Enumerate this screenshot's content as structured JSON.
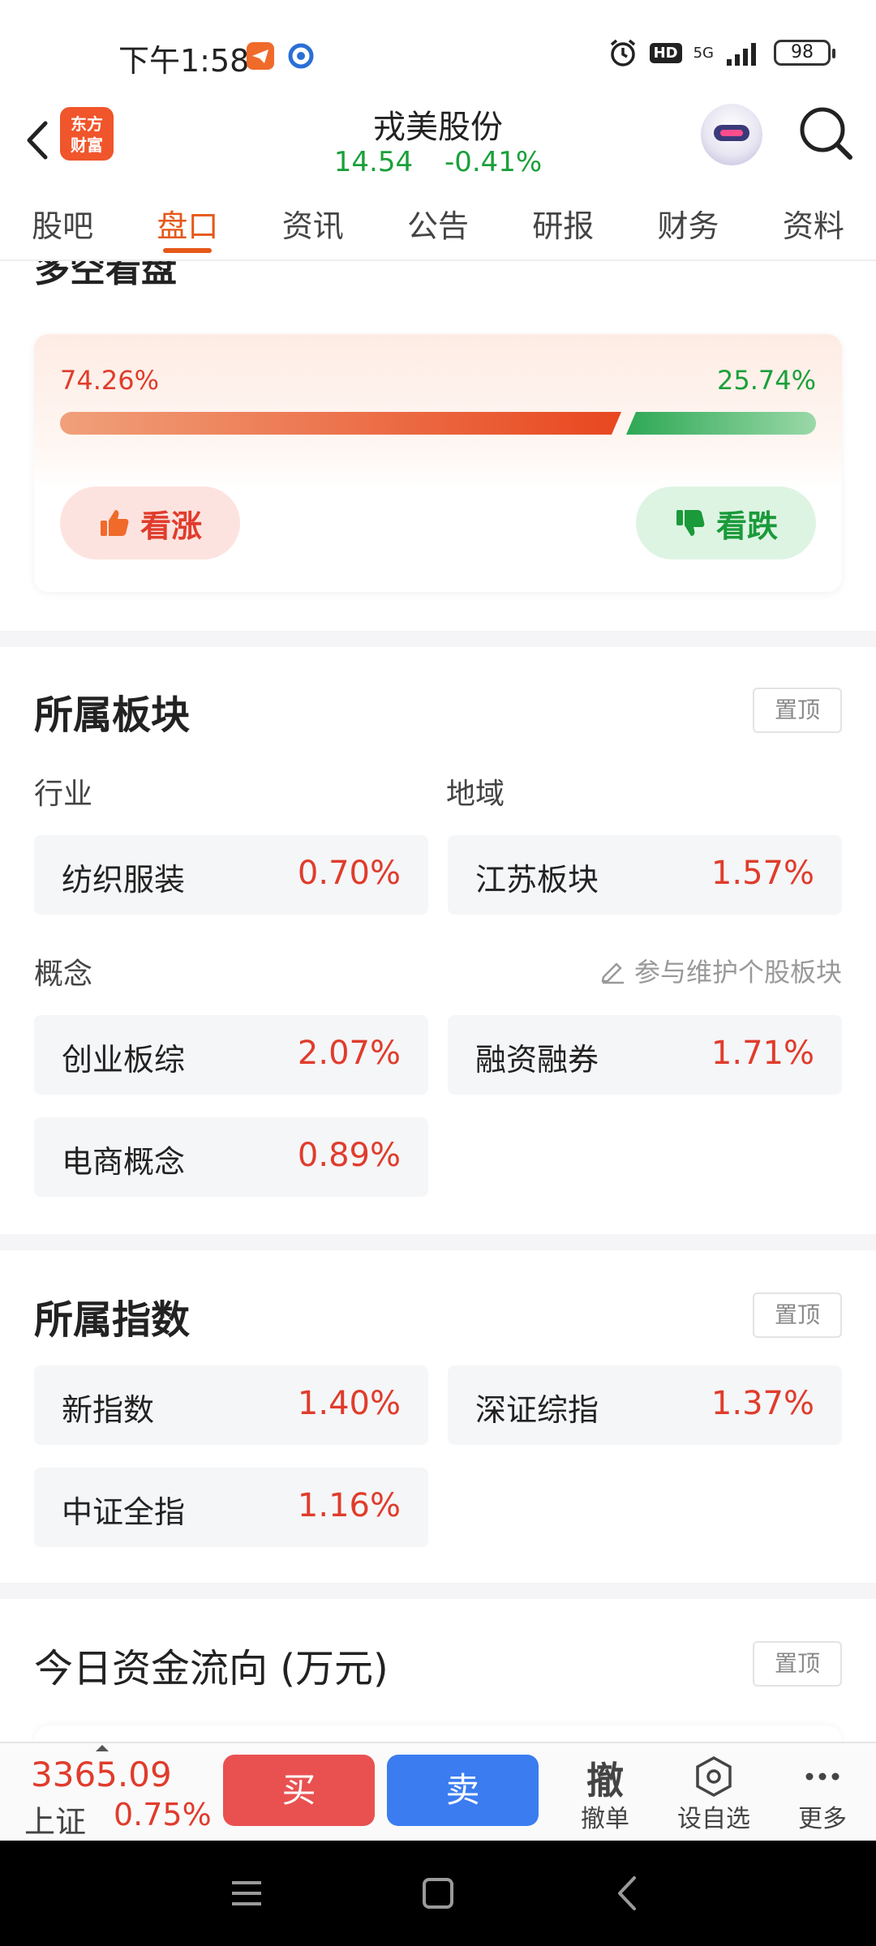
{
  "status_bar": {
    "time": "下午1:58",
    "network": "5G",
    "hd": "HD",
    "battery": "98"
  },
  "header": {
    "logo_text": "东方\n财富",
    "stock_name": "戎美股份",
    "price": "14.54",
    "change": "-0.41%"
  },
  "tabs": [
    {
      "label": "股吧"
    },
    {
      "label": "盘口"
    },
    {
      "label": "资讯"
    },
    {
      "label": "公告"
    },
    {
      "label": "研报"
    },
    {
      "label": "财务"
    },
    {
      "label": "资料"
    }
  ],
  "sentiment": {
    "title": "多空看盘",
    "bull_percent": "74.26%",
    "bear_percent": "25.74%",
    "bull_fraction": 0.7426,
    "bull_label": "看涨",
    "bear_label": "看跌"
  },
  "sectors": {
    "title": "所属板块",
    "pin_label": "置顶",
    "industry_label": "行业",
    "region_label": "地域",
    "concept_label": "概念",
    "maintain_link": "参与维护个股板块",
    "industry": [
      {
        "name": "纺织服装",
        "change": "0.70%"
      }
    ],
    "region": [
      {
        "name": "江苏板块",
        "change": "1.57%"
      }
    ],
    "concepts": [
      {
        "name": "创业板综",
        "change": "2.07%"
      },
      {
        "name": "融资融券",
        "change": "1.71%"
      },
      {
        "name": "电商概念",
        "change": "0.89%"
      }
    ]
  },
  "indices": {
    "title": "所属指数",
    "pin_label": "置顶",
    "items": [
      {
        "name": "新指数",
        "change": "1.40%"
      },
      {
        "name": "深证综指",
        "change": "1.37%"
      },
      {
        "name": "中证全指",
        "change": "1.16%"
      }
    ]
  },
  "fund_flow": {
    "title": "今日资金流向 (万元)",
    "pin_label": "置顶"
  },
  "trade_bar": {
    "index_value": "3365.09",
    "index_name": "上证",
    "index_change": "0.75%",
    "buy_label": "买",
    "sell_label": "卖",
    "cancel_char": "撤",
    "cancel_label": "撤单",
    "watchlist_label": "设自选",
    "more_label": "更多"
  },
  "colors": {
    "up": "#e03c2c",
    "down": "#1aa03a",
    "accent": "#e5581a",
    "buy": "#e95150",
    "sell": "#3b7cf0"
  }
}
